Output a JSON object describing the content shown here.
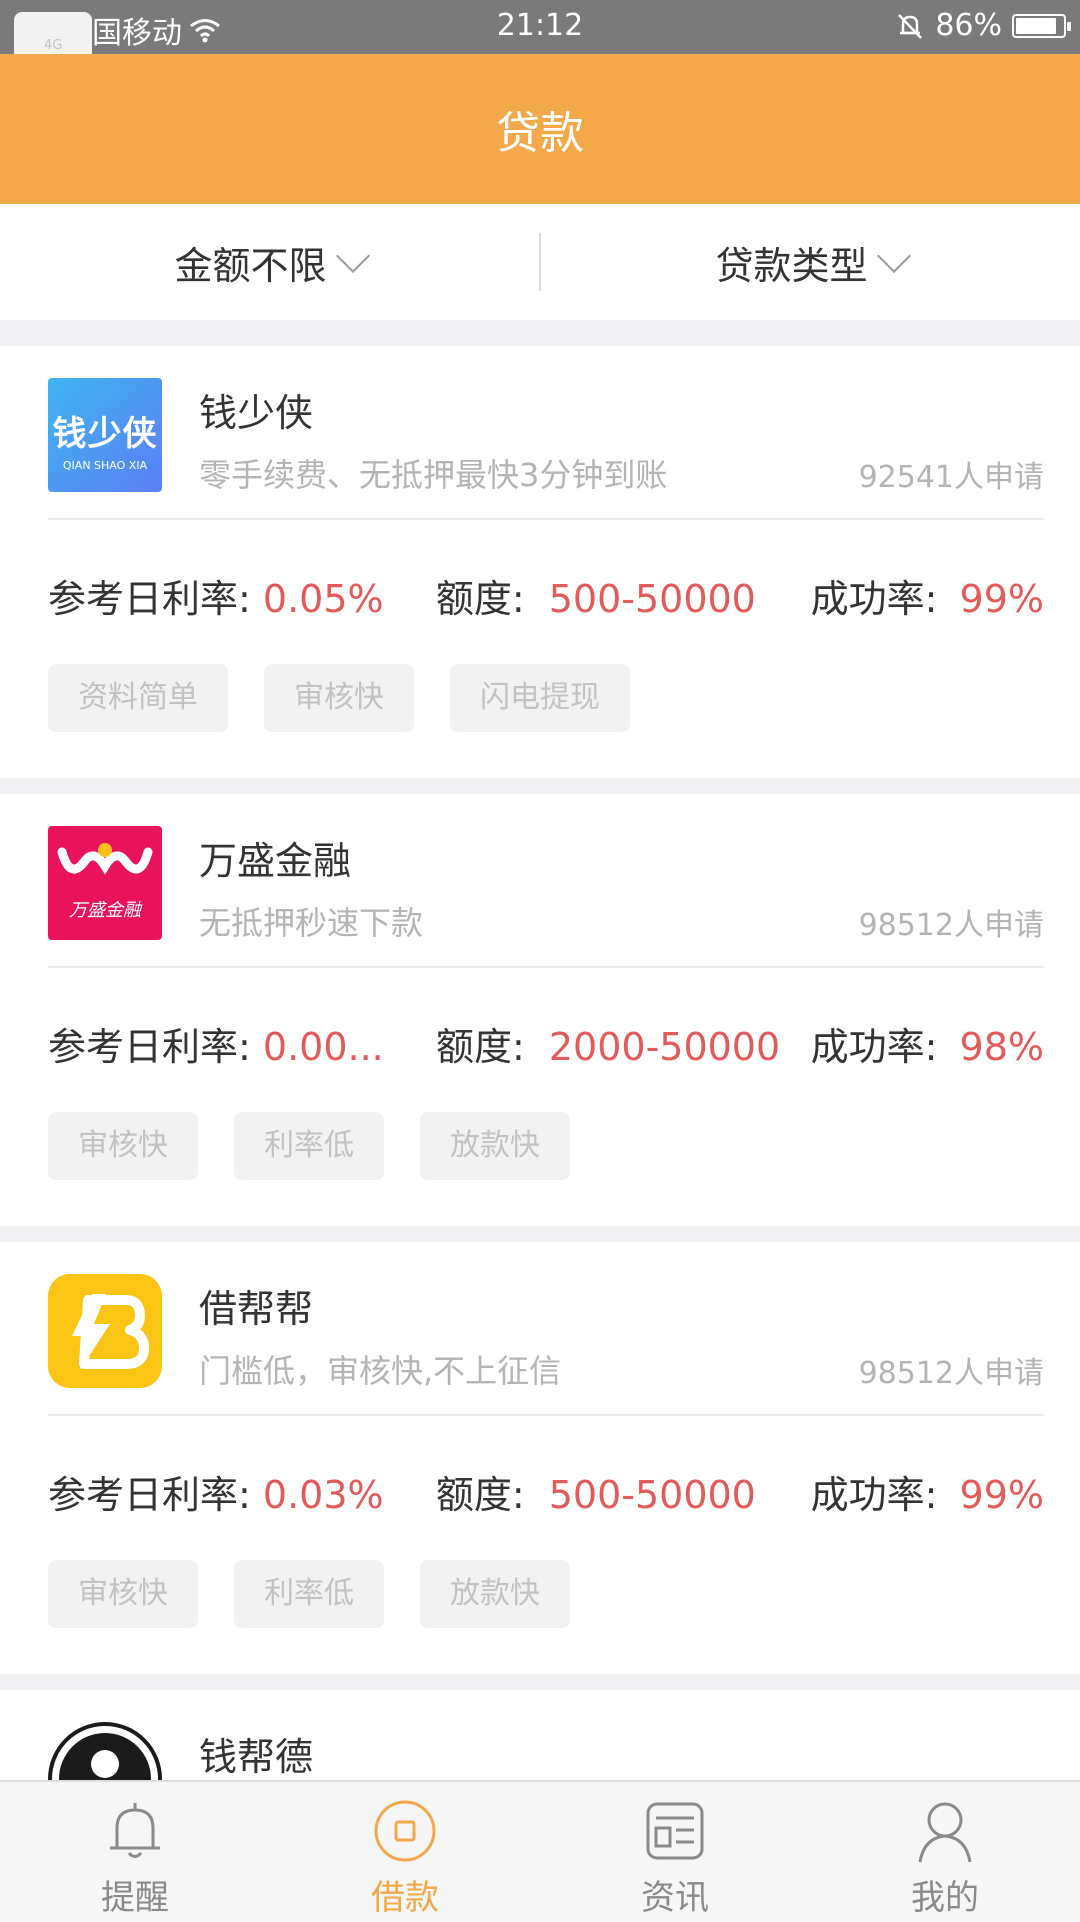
{
  "status_bar": {
    "network": "4G",
    "carrier": "中国移动",
    "time": "21:12",
    "battery": "86%",
    "battery_level": 0.86
  },
  "header": {
    "title": "贷款"
  },
  "filters": [
    {
      "label": "金额不限"
    },
    {
      "label": "贷款类型"
    }
  ],
  "products": [
    {
      "name": "钱少侠",
      "logo_text": "钱少侠",
      "logo_sub": "QIAN SHAO XIA",
      "description": "零手续费、无抵押最快3分钟到账",
      "applicants": "92541人申请",
      "rate_label": "参考日利率:",
      "rate": "0.05%",
      "amount_label": "额度:",
      "amount": "500-50000",
      "success_label": "成功率:",
      "success": "99%",
      "tags": [
        "资料简单",
        "审核快",
        "闪电提现"
      ]
    },
    {
      "name": "万盛金融",
      "logo_text": "万盛金融",
      "description": "无抵押秒速下款",
      "applicants": "98512人申请",
      "rate_label": "参考日利率:",
      "rate": "0.00...",
      "amount_label": "额度:",
      "amount": "2000-50000",
      "success_label": "成功率:",
      "success": "98%",
      "tags": [
        "审核快",
        "利率低",
        "放款快"
      ]
    },
    {
      "name": "借帮帮",
      "description": "门槛低，审核快,不上征信",
      "applicants": "98512人申请",
      "rate_label": "参考日利率:",
      "rate": "0.03%",
      "amount_label": "额度:",
      "amount": "500-50000",
      "success_label": "成功率:",
      "success": "99%",
      "tags": [
        "审核快",
        "利率低",
        "放款快"
      ]
    },
    {
      "name": "钱帮德"
    }
  ],
  "tabbar": [
    {
      "label": "提醒",
      "icon": "bell-icon",
      "active": false
    },
    {
      "label": "借款",
      "icon": "loan-icon",
      "active": true
    },
    {
      "label": "资讯",
      "icon": "news-icon",
      "active": false
    },
    {
      "label": "我的",
      "icon": "profile-icon",
      "active": false
    }
  ],
  "colors": {
    "accent": "#f3a849",
    "highlight_red": "#e25a5a",
    "muted": "#b4b4b4"
  }
}
